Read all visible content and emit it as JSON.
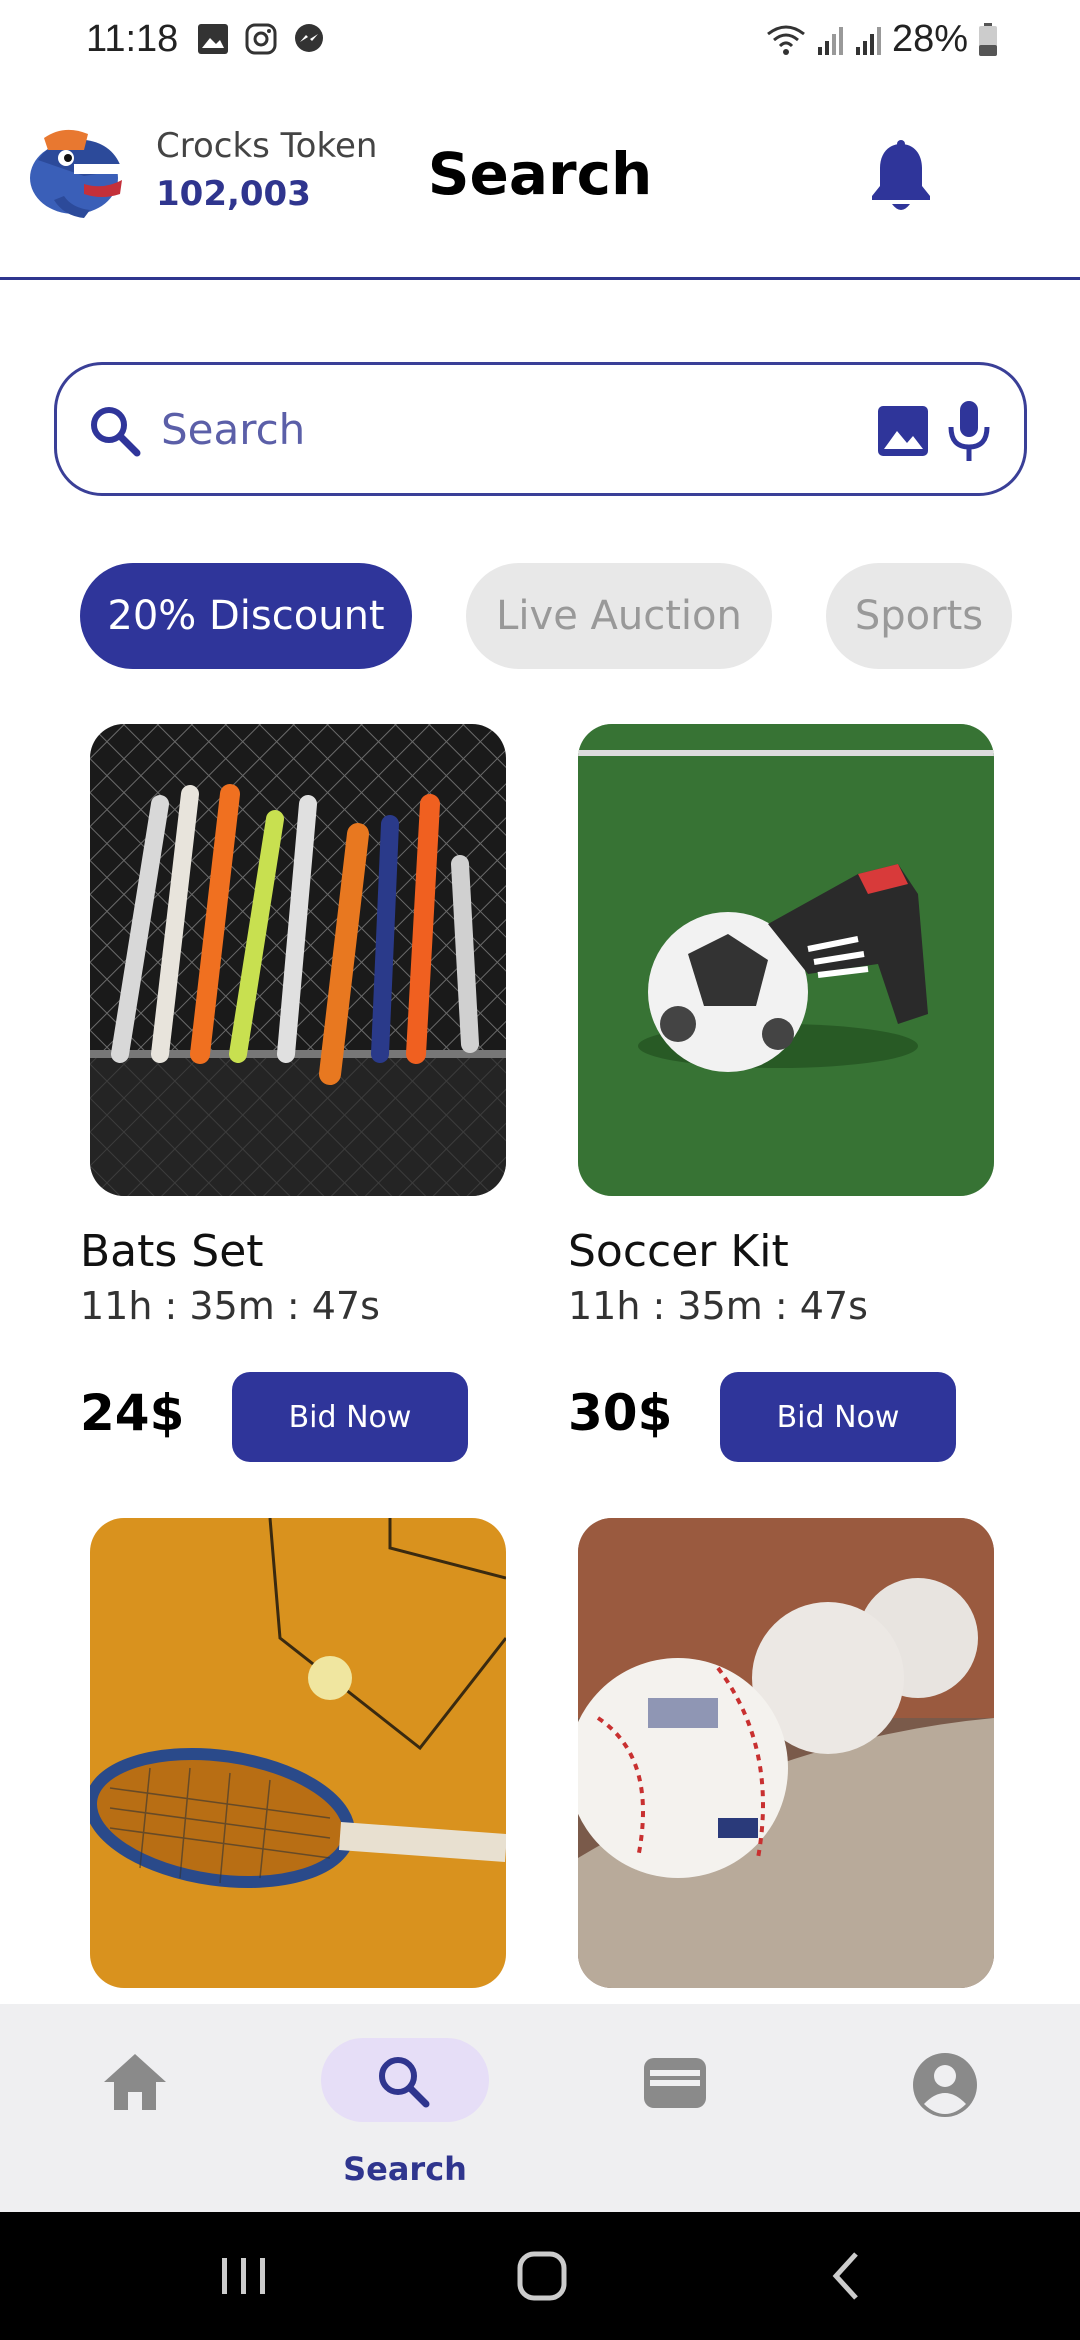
{
  "status_bar": {
    "time": "11:18",
    "battery": "28%"
  },
  "header": {
    "token_label": "Crocks Token",
    "token_value": "102,003",
    "title": "Search"
  },
  "search": {
    "placeholder": "Search"
  },
  "chips": [
    {
      "label": "20% Discount",
      "active": true
    },
    {
      "label": "Live Auction",
      "active": false
    },
    {
      "label": "Sports",
      "active": false
    }
  ],
  "products": [
    {
      "name": "Bats Set",
      "timer": "11h : 35m : 47s",
      "price": "24$",
      "bid_label": "Bid Now",
      "image": "baseball-bats-photo"
    },
    {
      "name": "Soccer Kit",
      "timer": "11h : 35m : 47s",
      "price": "30$",
      "bid_label": "Bid Now",
      "image": "soccer-ball-cleats-photo"
    },
    {
      "name": "",
      "timer": "",
      "price": "",
      "bid_label": "",
      "image": "tennis-racket-photo"
    },
    {
      "name": "",
      "timer": "",
      "price": "",
      "bid_label": "",
      "image": "baseballs-photo"
    }
  ],
  "bottom_nav": {
    "items": [
      {
        "icon": "home-icon",
        "label": ""
      },
      {
        "icon": "search-icon",
        "label": "Search",
        "active": true
      },
      {
        "icon": "wallet-icon",
        "label": ""
      },
      {
        "icon": "account-icon",
        "label": ""
      }
    ]
  },
  "colors": {
    "primary": "#2f359a",
    "chip_inactive": "#e8e8e8",
    "nav_bg": "#efeff1",
    "nav_pill": "#e6def7"
  }
}
